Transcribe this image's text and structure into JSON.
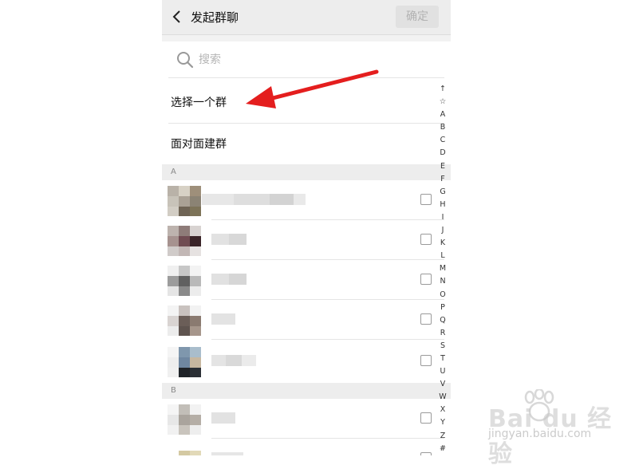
{
  "header": {
    "title": "发起群聊",
    "confirm_label": "确定"
  },
  "search": {
    "placeholder": "搜索"
  },
  "menu": {
    "select_group": "选择一个群",
    "face_to_face": "面对面建群"
  },
  "sections": [
    {
      "letter": "A"
    },
    {
      "letter": "B"
    }
  ],
  "index_letters": [
    "↑",
    "☆",
    "A",
    "B",
    "C",
    "D",
    "E",
    "F",
    "G",
    "H",
    "I",
    "J",
    "K",
    "L",
    "M",
    "N",
    "O",
    "P",
    "Q",
    "R",
    "S",
    "T",
    "U",
    "V",
    "W",
    "X",
    "Y",
    "Z",
    "#"
  ],
  "icons": {
    "back": "chevron-left-icon",
    "search": "search-icon",
    "annotation": "red-arrow-icon",
    "watermark": "baidu-paw-icon"
  },
  "colors": {
    "arrow": "#e41e1e",
    "header_bg": "#ededed",
    "confirm_text": "#b2b2b2"
  },
  "watermark": {
    "brand": "Bai du 经验",
    "url": "jingyan.baidu.com"
  }
}
